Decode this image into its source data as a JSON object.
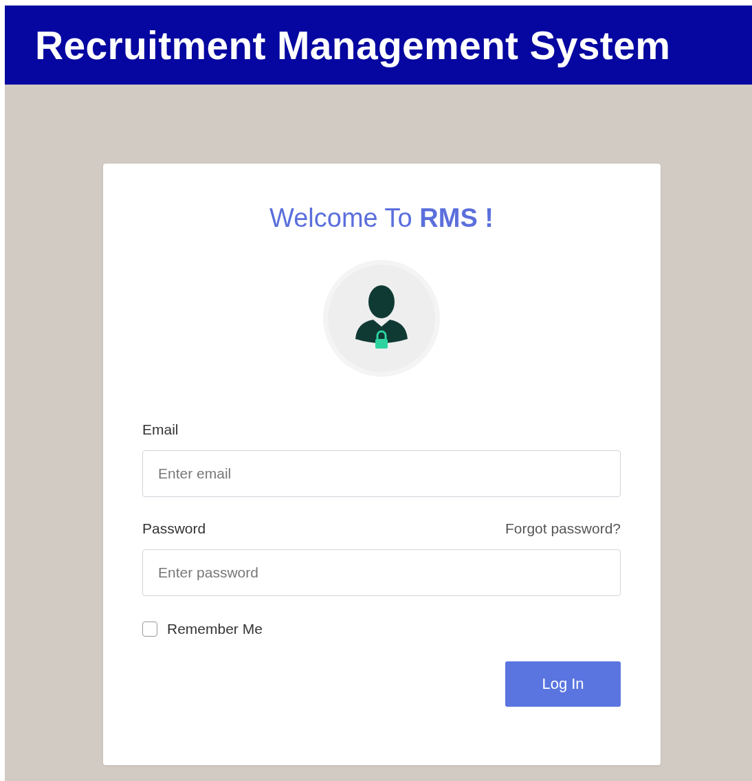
{
  "header": {
    "title": "Recruitment Management System"
  },
  "login": {
    "heading": "Welcome To **RMS !**",
    "email": {
      "label": "Email",
      "placeholder": "Enter email"
    },
    "password": {
      "label": "Password",
      "placeholder": "Enter password",
      "forgot_link": "Forgot password?"
    },
    "remember": {
      "label": "Remember Me",
      "checked": false
    },
    "submit": "Log In"
  }
}
